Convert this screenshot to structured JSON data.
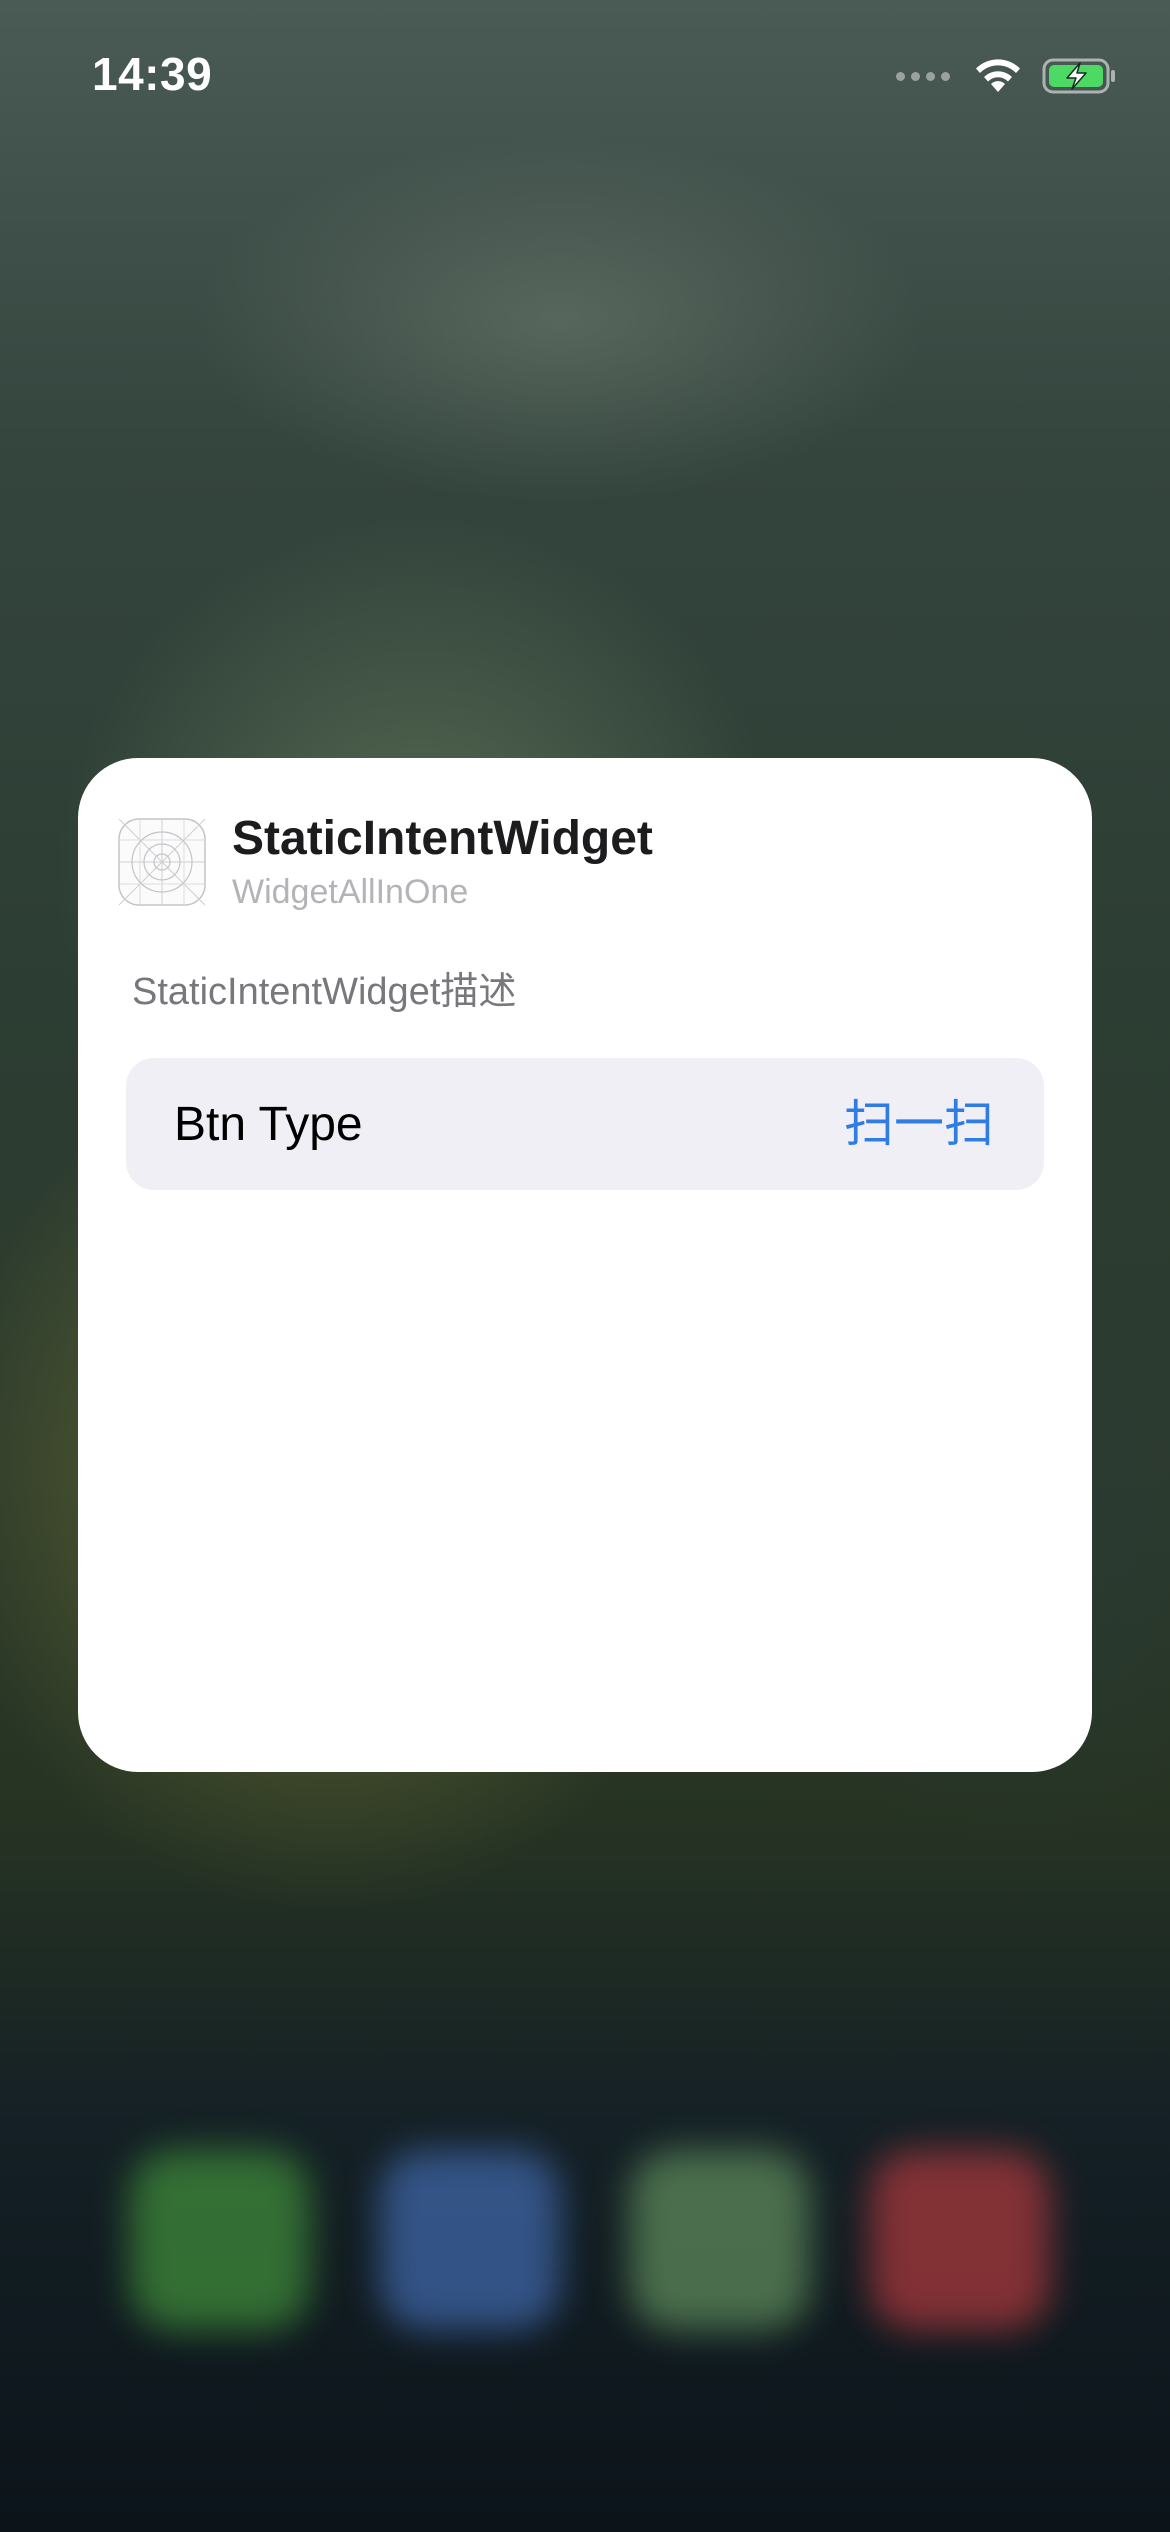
{
  "status_bar": {
    "time": "14:39",
    "icons": [
      "cellular-signal-icon",
      "wifi-icon",
      "battery-charging-icon"
    ]
  },
  "widget_config": {
    "title": "StaticIntentWidget",
    "app_name": "WidgetAllInOne",
    "description": "StaticIntentWidget描述",
    "app_icon": "app-placeholder-icon",
    "parameters": [
      {
        "label": "Btn Type",
        "value": "扫一扫"
      }
    ]
  },
  "colors": {
    "accent": "#2f7de2",
    "card_background": "#ffffff",
    "row_background": "#f0eff5",
    "secondary_text": "#77777c",
    "battery_green": "#4cd964"
  }
}
